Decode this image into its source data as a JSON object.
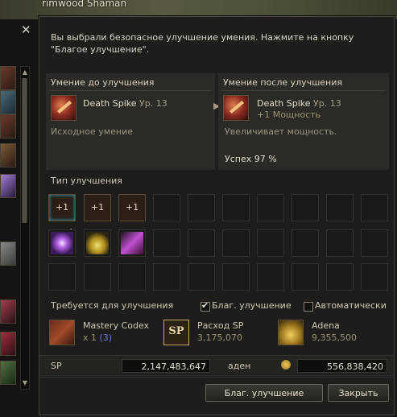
{
  "window": {
    "background_title": "rimwood Shaman",
    "close_icon": "x-icon",
    "notice": "Вы выбрали безопасное улучшение умения. Нажмите на кнопку \"Благое улучшение\"."
  },
  "before": {
    "header": "Умение до улучшения",
    "skill_name": "Death Spike",
    "skill_level": "Ур. 13",
    "description": "Исходное умение"
  },
  "after": {
    "header": "Умение после улучшения",
    "skill_name": "Death Spike",
    "skill_level": "Ур. 13",
    "modifier": "+1 Мощность",
    "description": "Увеличивает мощность.",
    "success": "Успех 97 %"
  },
  "enhance_type": {
    "label": "Тип улучшения",
    "options": [
      "+1",
      "+1",
      "+1"
    ]
  },
  "requirements": {
    "label": "Требуется для улучшения",
    "blessed_label": "Благ. улучшение",
    "auto_label": "Автоматически",
    "blessed_checked": true,
    "auto_checked": false,
    "items": [
      {
        "name": "Mastery Codex",
        "value_prefix": "x 1",
        "value_have": "(3)"
      },
      {
        "name": "Расход SP",
        "value": "3,175,070",
        "icon_text": "SP"
      },
      {
        "name": "Adena",
        "value": "9,355,500"
      }
    ]
  },
  "totals": {
    "sp_label": "SP",
    "sp_value": "2,147,483,647",
    "adena_label": "аден",
    "adena_value": "556,838,420"
  },
  "buttons": {
    "blessed": "Благ. улучшение",
    "close": "Закрыть"
  },
  "colors": {
    "selected_cell": "#5ad0e0",
    "highlight_blue": "#6a7bd6"
  }
}
